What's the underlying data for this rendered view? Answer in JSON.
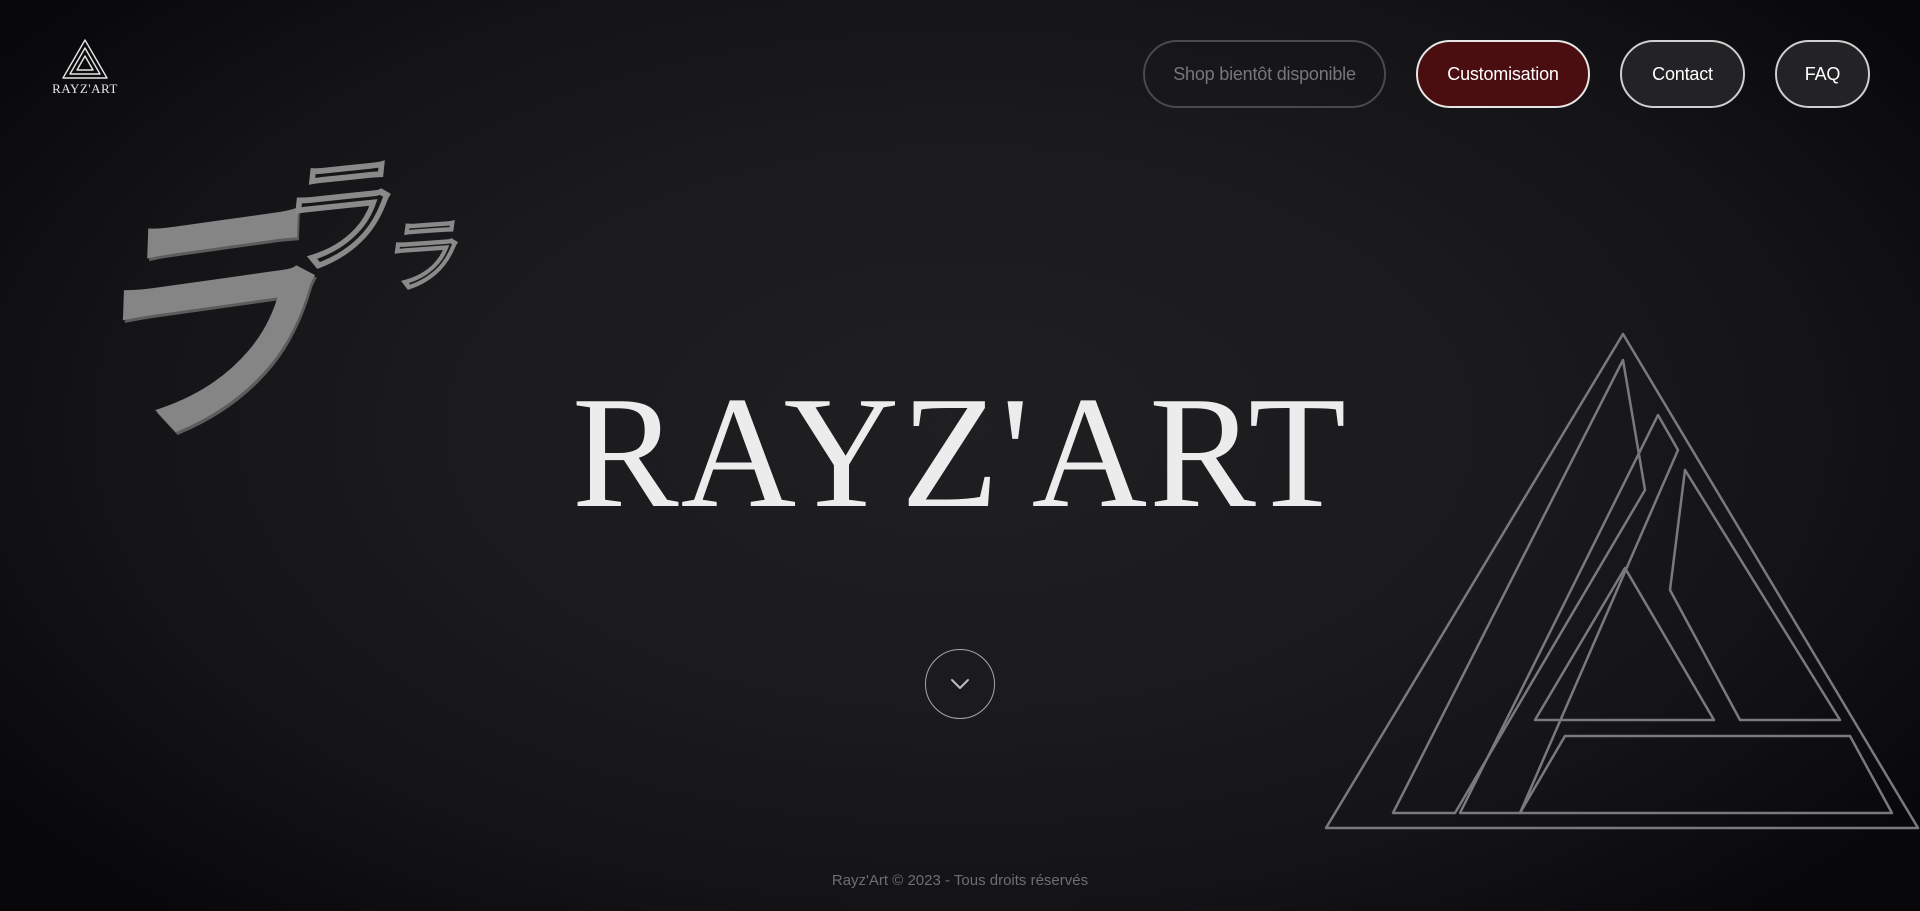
{
  "brand": {
    "logo_text": "RAYZ'ART"
  },
  "nav": {
    "shop_label": "Shop bientôt disponible",
    "custom_label": "Customisation",
    "contact_label": "Contact",
    "faq_label": "FAQ"
  },
  "hero": {
    "title": "RAYZ'ART",
    "kana_big": "ラ",
    "kana_mid": "ラ",
    "kana_small": "ラ"
  },
  "footer": {
    "text": "Rayz'Art © 2023 - Tous droits réservés"
  },
  "icons": {
    "scroll": "chevron-down-icon",
    "logo": "triangle-logo-icon",
    "decor": "triangle-emblem-icon"
  },
  "colors": {
    "background": "#1b1b1e",
    "accent": "#4a0d10",
    "text": "#ececec"
  }
}
